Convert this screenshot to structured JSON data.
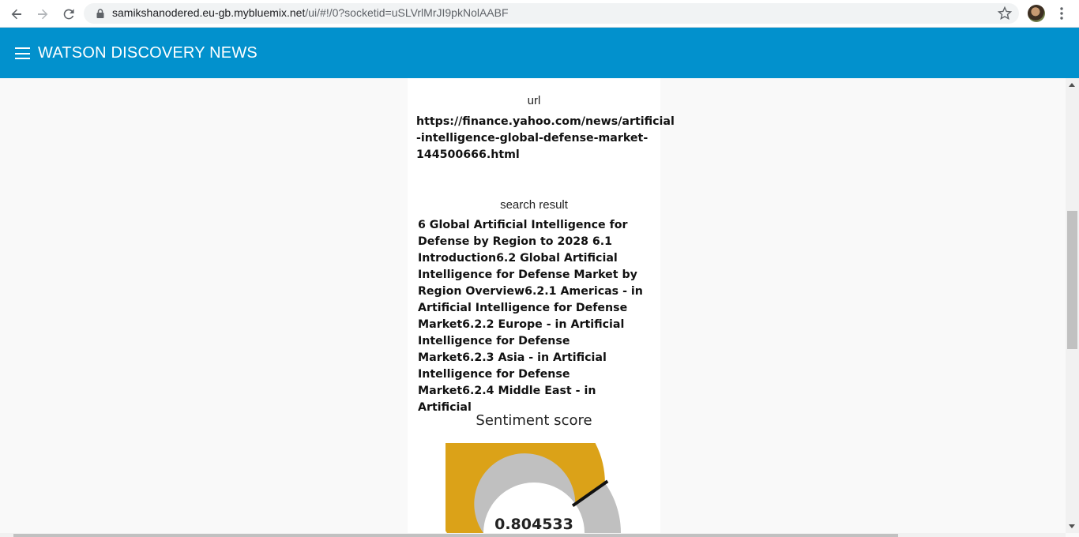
{
  "browser": {
    "url_host": "samikshanodered.eu-gb.mybluemix.net",
    "url_path": "/ui/#!/0?socketid=uSLVrlMrJI9pkNolAABF"
  },
  "header": {
    "title": "WATSON DISCOVERY NEWS"
  },
  "card": {
    "url_label": "url",
    "url_value": "https://finance.yahoo.com/news/artificial-intelligence-global-defense-market-144500666.html",
    "search_label": "search result",
    "search_value": "6 Global Artificial Intelligence for Defense by Region to 2028 6.1 Introduction6.2 Global Artificial Intelligence for Defense Market by Region Overview6.2.1 Americas - in Artificial Intelligence for Defense Market6.2.2 Europe - in Artificial Intelligence for Defense Market6.2.3 Asia - in Artificial Intelligence for Defense Market6.2.4 Middle East - in Artificial",
    "sentiment_title": "Sentiment score",
    "sentiment_value": "0.804533",
    "sentiment_fraction": 0.804533,
    "gauge_colors": {
      "fill": "#dba218",
      "track": "#c0c0c0",
      "needle": "#111111"
    }
  },
  "colors": {
    "header_bg": "#0291cd",
    "page_bg": "#f9f9f9"
  }
}
